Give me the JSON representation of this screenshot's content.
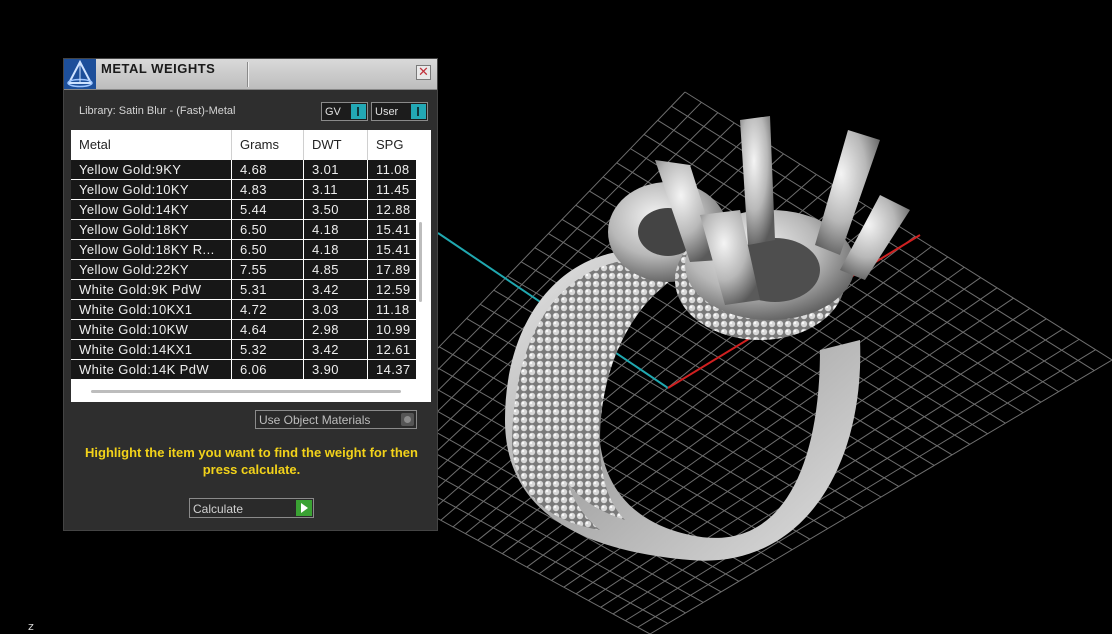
{
  "panel": {
    "title": "METAL WEIGHTS",
    "close_label": "✕",
    "library_label": "Library: Satin Blur - (Fast)-Metal",
    "toggles": [
      {
        "label": "GV"
      },
      {
        "label": "User"
      }
    ],
    "use_object_materials_label": "Use Object Materials",
    "hint": "Highlight the item you want to find the weight for then press calculate.",
    "calculate_label": "Calculate"
  },
  "table": {
    "columns": [
      "Metal",
      "Grams",
      "DWT",
      "SPG"
    ],
    "rows": [
      [
        "Yellow Gold:9KY",
        "4.68",
        "3.01",
        "11.08"
      ],
      [
        "Yellow Gold:10KY",
        "4.83",
        "3.11",
        "11.45"
      ],
      [
        "Yellow Gold:14KY",
        "5.44",
        "3.50",
        "12.88"
      ],
      [
        "Yellow Gold:18KY",
        "6.50",
        "4.18",
        "15.41"
      ],
      [
        "Yellow Gold:18KY R...",
        "6.50",
        "4.18",
        "15.41"
      ],
      [
        "Yellow Gold:22KY",
        "7.55",
        "4.85",
        "17.89"
      ],
      [
        "White Gold:9K PdW",
        "5.31",
        "3.42",
        "12.59"
      ],
      [
        "White Gold:10KX1",
        "4.72",
        "3.03",
        "11.18"
      ],
      [
        "White Gold:10KW",
        "4.64",
        "2.98",
        "10.99"
      ],
      [
        "White Gold:14KX1",
        "5.32",
        "3.42",
        "12.61"
      ],
      [
        "White Gold:14K PdW",
        "6.06",
        "3.90",
        "14.37"
      ]
    ]
  },
  "viewport": {
    "axis_label": "z",
    "colors": {
      "grid": "#8a8a8a",
      "x_axis": "#d02020",
      "y_axis": "#20a8b0",
      "accent": "#23a8b5",
      "hint_text": "#f2d21a"
    }
  }
}
